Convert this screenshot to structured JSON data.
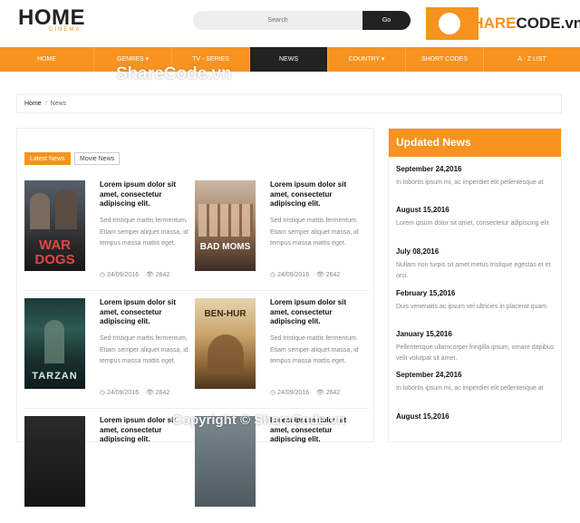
{
  "logo": {
    "main": "HOME",
    "sub": "CINEMA"
  },
  "search": {
    "placeholder": "Search",
    "button": "Go"
  },
  "brand": {
    "text_pre": "SHARE",
    "text_post": "CODE.vn"
  },
  "nav": [
    {
      "label": "HOME"
    },
    {
      "label": "GENRES ▾"
    },
    {
      "label": "TV - SERIES"
    },
    {
      "label": "NEWS"
    },
    {
      "label": "COUNTRY ▾"
    },
    {
      "label": "SHORT CODES"
    },
    {
      "label": "A - Z LIST"
    }
  ],
  "watermark_top": "ShareCode.vn",
  "breadcrumb": {
    "home": "Home",
    "separator": "/",
    "current": "News"
  },
  "tabs": {
    "latest": "Latest News",
    "movie": "Movie News"
  },
  "cards": [
    {
      "poster_text": "WAR DOGS",
      "title": "Lorem ipsum dolor sit amet, consectetur adipiscing elit.",
      "desc": "Sed tristique mattis fermentum. Etiam semper aliquet massa, id tempus massa mattis eget.",
      "date": "24/09/2016",
      "views": "2642"
    },
    {
      "poster_text": "BAD MOMS",
      "title": "Lorem ipsum dolor sit amet, consectetur adipiscing elit.",
      "desc": "Sed tristique mattis fermentum. Etiam semper aliquet massa, id tempus massa mattis eget.",
      "date": "24/09/2016",
      "views": "2642"
    },
    {
      "poster_text": "TARZAN",
      "title": "Lorem ipsum dolor sit amet, consectetur adipiscing elit.",
      "desc": "Sed tristique mattis fermentum. Etiam semper aliquet massa, id tempus massa mattis eget.",
      "date": "24/09/2016",
      "views": "2642"
    },
    {
      "poster_text": "BEN-HUR",
      "title": "Lorem ipsum dolor sit amet, consectetur adipiscing elit.",
      "desc": "Sed tristique mattis fermentum. Etiam semper aliquet massa, id tempus massa mattis eget.",
      "date": "24/09/2016",
      "views": "2642"
    },
    {
      "poster_text": "",
      "title": "Lorem ipsum dolor sit amet, consectetur adipiscing elit.",
      "desc": "",
      "date": "",
      "views": ""
    },
    {
      "poster_text": "",
      "title": "Lorem ipsum dolor sit amet, consectetur adipiscing elit.",
      "desc": "",
      "date": "",
      "views": ""
    }
  ],
  "sidebar": {
    "heading": "Updated News",
    "items": [
      {
        "date": "September 24,2016",
        "text": "In lobortis ipsum mi, ac imperdiet elit pellentesque at"
      },
      {
        "date": "August 15,2016",
        "text": "Lorem ipsum dolor sit amet, consectetur adipiscing elit"
      },
      {
        "date": "July 08,2016",
        "text": "Nullam non turpis sit amet metus tristique egestas et et orci."
      },
      {
        "date": "February 15,2016",
        "text": "Duis venenatis ac ipsum vel ultricies in placerat quam"
      },
      {
        "date": "January 15,2016",
        "text": "Pellentesque ullamcorper fringilla ipsum, ornare dapibus velit volutpat sit amet."
      },
      {
        "date": "September 24,2016",
        "text": "In lobortis ipsum mi, ac imperdiet elit pellentesque at"
      },
      {
        "date": "August 15,2016",
        "text": ""
      }
    ]
  },
  "watermark_bottom": "Copyright © ShareCode.vn",
  "colors": {
    "accent": "#f7931e",
    "dark": "#222222"
  }
}
